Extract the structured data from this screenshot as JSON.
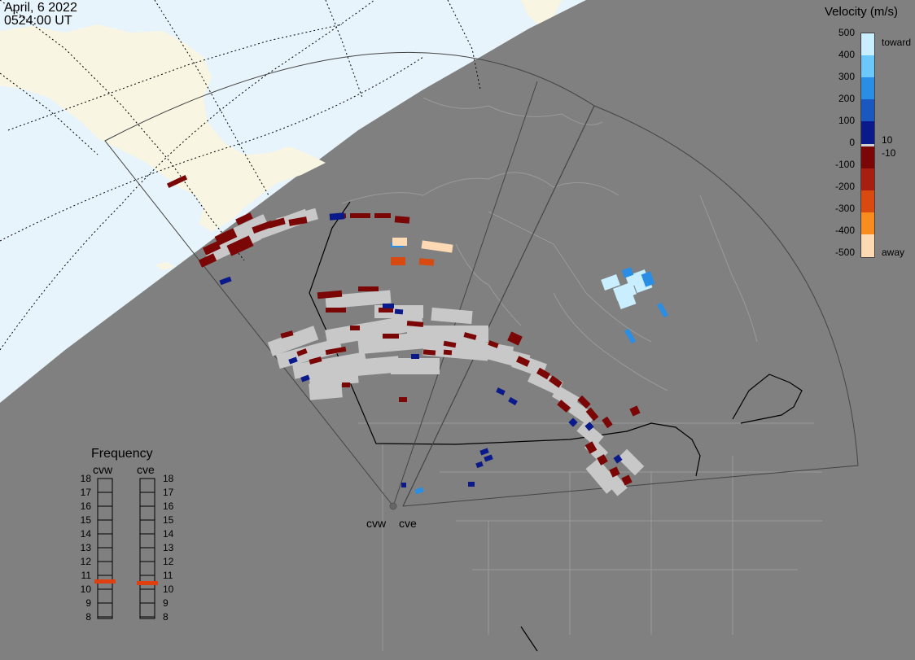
{
  "header": {
    "date": "April, 6 2022",
    "time": "0524:00 UT"
  },
  "velocity_legend": {
    "title": "Velocity (m/s)",
    "ticks": [
      "500",
      "400",
      "300",
      "200",
      "100",
      "0",
      "-100",
      "-200",
      "-300",
      "-400",
      "-500"
    ],
    "toward_label": "toward",
    "away_label": "away",
    "threshold_pos": "10",
    "threshold_neg": "-10",
    "colors": {
      "ground_scatter": "#c8c8c8",
      "toward_strong": "#c9eeff",
      "toward_mid": "#2a8ee4",
      "toward_weak": "#0b1a8a",
      "away_weak": "#7a0606",
      "away_mid": "#d84a10",
      "away_strong": "#fdd9b4"
    }
  },
  "frequency": {
    "title": "Frequency",
    "radars": [
      "cvw",
      "cve"
    ],
    "ticks": [
      "18",
      "17",
      "16",
      "15",
      "14",
      "13",
      "12",
      "11",
      "10",
      "9",
      "8"
    ],
    "cvw_mhz": 10.8,
    "cve_mhz": 10.7
  },
  "sites": [
    "cvw",
    "cve"
  ]
}
